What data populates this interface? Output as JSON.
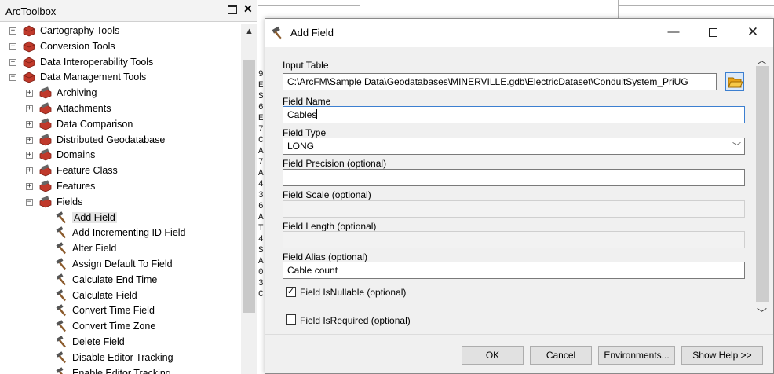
{
  "toolbox": {
    "title": "ArcToolbox",
    "items": [
      {
        "label": "Cartography Tools",
        "kind": "red-toolbox",
        "expander": "+"
      },
      {
        "label": "Conversion Tools",
        "kind": "red-toolbox",
        "expander": "+"
      },
      {
        "label": "Data Interoperability Tools",
        "kind": "red-toolbox",
        "expander": "+"
      },
      {
        "label": "Data Management Tools",
        "kind": "red-toolbox",
        "expander": "−"
      },
      {
        "label": "Archiving",
        "kind": "toolset",
        "expander": "+"
      },
      {
        "label": "Attachments",
        "kind": "toolset",
        "expander": "+"
      },
      {
        "label": "Data Comparison",
        "kind": "toolset",
        "expander": "+"
      },
      {
        "label": "Distributed Geodatabase",
        "kind": "toolset",
        "expander": "+"
      },
      {
        "label": "Domains",
        "kind": "toolset",
        "expander": "+"
      },
      {
        "label": "Feature Class",
        "kind": "toolset",
        "expander": "+"
      },
      {
        "label": "Features",
        "kind": "toolset",
        "expander": "+"
      },
      {
        "label": "Fields",
        "kind": "toolset",
        "expander": "−"
      },
      {
        "label": "Add Field",
        "kind": "tool",
        "selected": true
      },
      {
        "label": "Add Incrementing ID Field",
        "kind": "tool"
      },
      {
        "label": "Alter Field",
        "kind": "tool"
      },
      {
        "label": "Assign Default To Field",
        "kind": "tool"
      },
      {
        "label": "Calculate End Time",
        "kind": "tool"
      },
      {
        "label": "Calculate Field",
        "kind": "tool"
      },
      {
        "label": "Convert Time Field",
        "kind": "tool"
      },
      {
        "label": "Convert Time Zone",
        "kind": "tool"
      },
      {
        "label": "Delete Field",
        "kind": "tool"
      },
      {
        "label": "Disable Editor Tracking",
        "kind": "tool"
      },
      {
        "label": "Enable Editor Tracking",
        "kind": "tool"
      }
    ]
  },
  "background": {
    "strip_chars": [
      "9",
      "E",
      "S",
      "6",
      "E",
      "7",
      "C",
      "A",
      "7",
      "A",
      "4",
      "3",
      "6",
      "A",
      "T",
      "4",
      "S",
      "A",
      "0",
      "3",
      "C"
    ]
  },
  "dialog": {
    "title": "Add Field",
    "input_table": {
      "label": "Input Table",
      "value": "C:\\ArcFM\\Sample Data\\Geodatabases\\MINERVILLE.gdb\\ElectricDataset\\ConduitSystem_PriUG"
    },
    "field_name": {
      "label": "Field Name",
      "value": "Cables"
    },
    "field_type": {
      "label": "Field Type",
      "value": "LONG"
    },
    "field_precision": {
      "label": "Field Precision (optional)",
      "value": ""
    },
    "field_scale": {
      "label": "Field Scale (optional)",
      "value": ""
    },
    "field_length": {
      "label": "Field Length (optional)",
      "value": ""
    },
    "field_alias": {
      "label": "Field Alias (optional)",
      "value": "Cable count"
    },
    "is_nullable": {
      "label": "Field IsNullable (optional)",
      "checked": true
    },
    "is_required": {
      "label": "Field IsRequired (optional)",
      "checked": false
    },
    "buttons": {
      "ok": "OK",
      "cancel": "Cancel",
      "environments": "Environments...",
      "help": "Show Help >>"
    }
  },
  "colors": {
    "red_toolbox": "#c0392b",
    "focus_border": "#3c7fd0",
    "folder": "#e8a317"
  }
}
